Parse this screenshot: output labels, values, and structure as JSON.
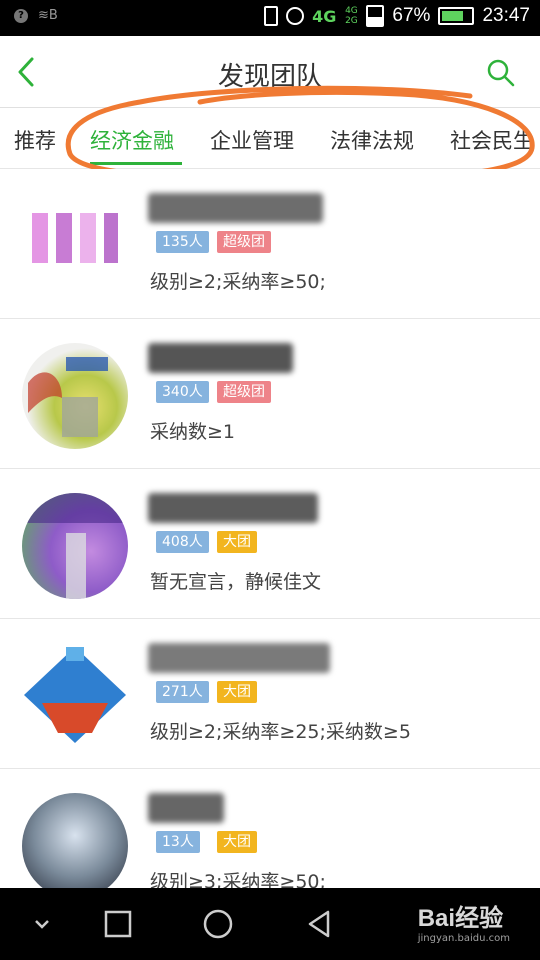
{
  "status_bar": {
    "carrier": "≋B",
    "network": "4G",
    "network_sub": "4G 2G",
    "battery_percent": "67%",
    "time": "23:47"
  },
  "header": {
    "title": "发现团队",
    "back_icon": "chevron-left-icon",
    "search_icon": "search-icon"
  },
  "tabs": [
    {
      "label": "推荐",
      "active": false
    },
    {
      "label": "经济金融",
      "active": true
    },
    {
      "label": "企业管理",
      "active": false
    },
    {
      "label": "法律法规",
      "active": false
    },
    {
      "label": "社会民生",
      "active": false
    }
  ],
  "teams": [
    {
      "members": "135人",
      "type": "超级团",
      "declaration": "级别≥2;采纳率≥50;"
    },
    {
      "members": "340人",
      "type": "超级团",
      "declaration": "采纳数≥1"
    },
    {
      "members": "408人",
      "type": "大团",
      "declaration": "暂无宣言，静候佳文"
    },
    {
      "members": "271人",
      "type": "大团",
      "declaration": "级别≥2;采纳率≥25;采纳数≥5"
    },
    {
      "members": "13人",
      "type": "大团",
      "declaration": "级别≥3;采纳率≥50;"
    }
  ],
  "navbar": {
    "back": "triangle-back-icon",
    "home": "circle-home-icon",
    "recents": "square-recents-icon",
    "menu": "chevron-down-icon"
  },
  "watermark": {
    "logo": "Bai经验",
    "url": "jingyan.baidu.com"
  },
  "colors": {
    "accent": "#2eb23a",
    "annotation": "#f07a33",
    "badge_count": "#86b3de",
    "badge_super": "#ee8389",
    "badge_big": "#f2b51f"
  }
}
